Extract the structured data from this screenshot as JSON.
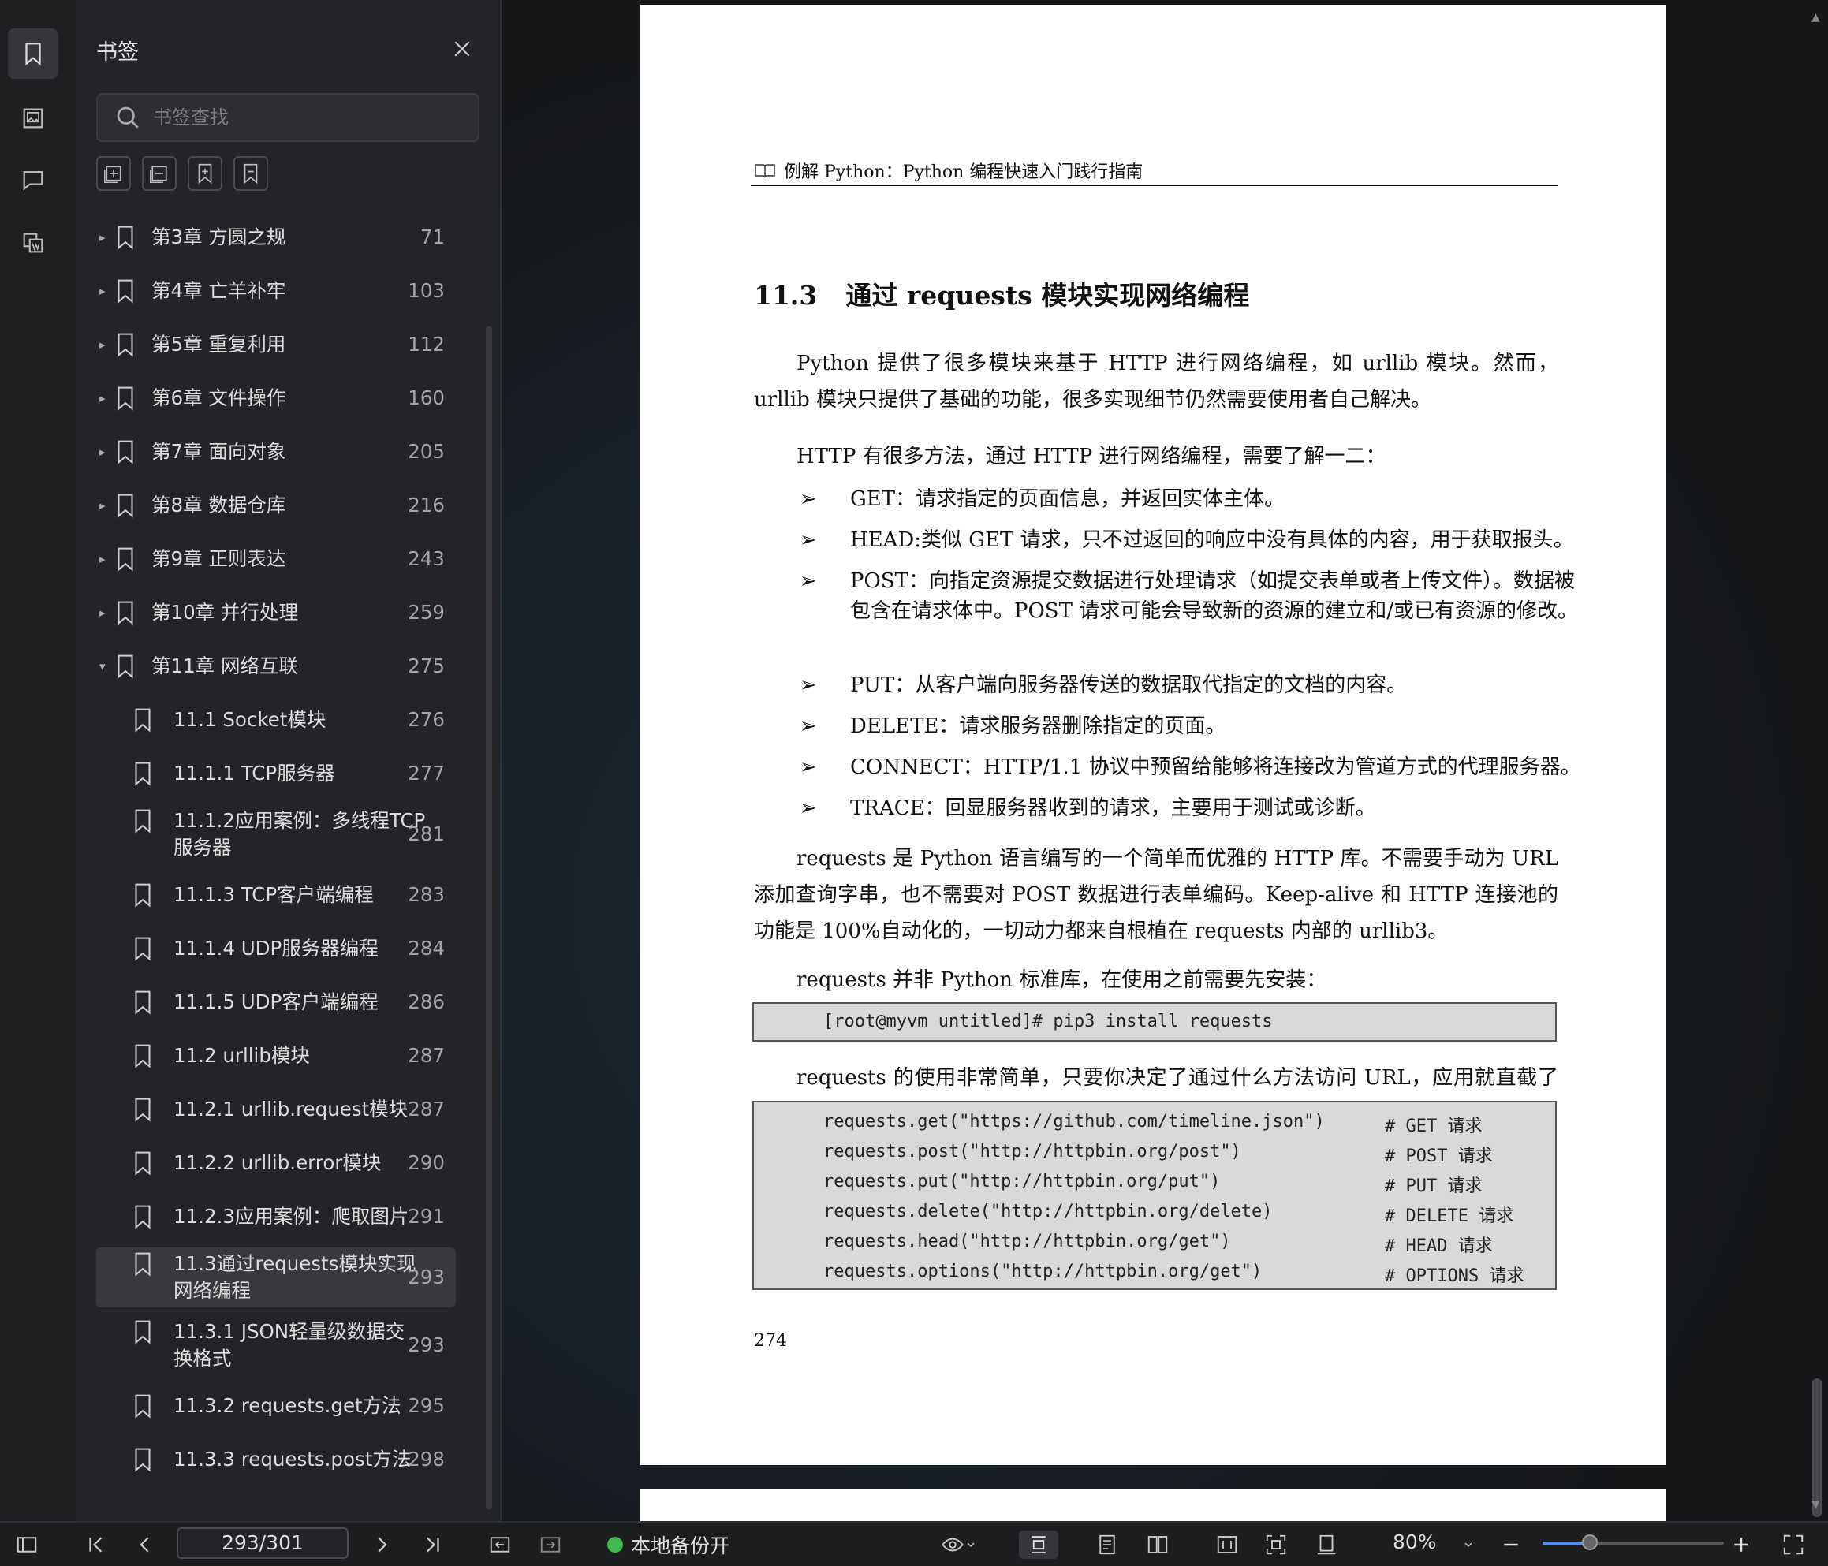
{
  "sidebar": {
    "title": "书签",
    "search_placeholder": "书签查找",
    "items": [
      {
        "label": "第3章 方圆之规",
        "page": "71",
        "level": 0,
        "caret": "▸"
      },
      {
        "label": "第4章 亡羊补牢",
        "page": "103",
        "level": 0,
        "caret": "▸"
      },
      {
        "label": "第5章 重复利用",
        "page": "112",
        "level": 0,
        "caret": "▸"
      },
      {
        "label": "第6章 文件操作",
        "page": "160",
        "level": 0,
        "caret": "▸"
      },
      {
        "label": "第7章 面向对象",
        "page": "205",
        "level": 0,
        "caret": "▸"
      },
      {
        "label": "第8章 数据仓库",
        "page": "216",
        "level": 0,
        "caret": "▸"
      },
      {
        "label": "第9章 正则表达",
        "page": "243",
        "level": 0,
        "caret": "▸"
      },
      {
        "label": "第10章 并行处理",
        "page": "259",
        "level": 0,
        "caret": "▸"
      },
      {
        "label": "第11章 网络互联",
        "page": "275",
        "level": 0,
        "caret": "▾"
      },
      {
        "label": "11.1 Socket模块",
        "page": "276",
        "level": 1
      },
      {
        "label": "11.1.1 TCP服务器",
        "page": "277",
        "level": 1
      },
      {
        "label": "11.1.2应用案例：多线程TCP",
        "label2": "服务器",
        "page": "281",
        "level": 1
      },
      {
        "label": "11.1.3 TCP客户端编程",
        "page": "283",
        "level": 1
      },
      {
        "label": "11.1.4 UDP服务器编程",
        "page": "284",
        "level": 1
      },
      {
        "label": "11.1.5 UDP客户端编程",
        "page": "286",
        "level": 1
      },
      {
        "label": "11.2 urllib模块",
        "page": "287",
        "level": 1
      },
      {
        "label": "11.2.1 urllib.request模块",
        "page": "287",
        "level": 1
      },
      {
        "label": "11.2.2 urllib.error模块",
        "page": "290",
        "level": 1
      },
      {
        "label": "11.2.3应用案例：爬取图片",
        "page": "291",
        "level": 1
      },
      {
        "label": "11.3通过requests模块实现",
        "label2": "网络编程",
        "page": "293",
        "level": 1,
        "selected": true
      },
      {
        "label": "11.3.1 JSON轻量级数据交",
        "label2": "换格式",
        "page": "293",
        "level": 1
      },
      {
        "label": "11.3.2 requests.get方法",
        "page": "295",
        "level": 1
      },
      {
        "label": "11.3.3 requests.post方法",
        "page": "298",
        "level": 1
      }
    ]
  },
  "document": {
    "running_head": "例解 Python：Python 编程快速入门践行指南",
    "section_number": "11.3",
    "section_title": "通过 requests 模块实现网络编程",
    "p1": "Python 提供了很多模块来基于 HTTP 进行网络编程，如 urllib 模块。然而，urllib 模块只提供了基础的功能，很多实现细节仍然需要使用者自己解决。",
    "p2": "HTTP 有很多方法，通过 HTTP 进行网络编程，需要了解一二：",
    "bullet_marker": "➢",
    "bullets": [
      "GET：请求指定的页面信息，并返回实体主体。",
      "HEAD:类似 GET 请求，只不过返回的响应中没有具体的内容，用于获取报头。",
      "POST：向指定资源提交数据进行处理请求（如提交表单或者上传文件）。数据被包含在请求体中。POST 请求可能会导致新的资源的建立和/或已有资源的修改。",
      "PUT：从客户端向服务器传送的数据取代指定的文档的内容。",
      "DELETE：请求服务器删除指定的页面。",
      "CONNECT：HTTP/1.1 协议中预留给能够将连接改为管道方式的代理服务器。",
      "TRACE：回显服务器收到的请求，主要用于测试或诊断。"
    ],
    "p3": "requests 是 Python 语言编写的一个简单而优雅的 HTTP 库。不需要手动为 URL 添加查询字串，也不需要对 POST 数据进行表单编码。Keep-alive 和 HTTP 连接池的功能是 100%自动化的，一切动力都来自根植在 requests 内部的 urllib3。",
    "p4": "requests 并非 Python 标准库，在使用之前需要先安装：",
    "code1": "[root@myvm untitled]# pip3 install requests",
    "p5": "requests 的使用非常简单，只要你决定了通过什么方法访问 URL，应用就直截了当：",
    "code2": [
      {
        "code": "requests.get(\"https://github.com/timeline.json\")",
        "comment": "# GET 请求"
      },
      {
        "code": "requests.post(\"http://httpbin.org/post\")",
        "comment": "# POST 请求"
      },
      {
        "code": "requests.put(\"http://httpbin.org/put\")",
        "comment": "# PUT 请求"
      },
      {
        "code": "requests.delete(\"http://httpbin.org/delete)",
        "comment": "# DELETE 请求"
      },
      {
        "code": "requests.head(\"http://httpbin.org/get\")",
        "comment": "# HEAD 请求"
      },
      {
        "code": "requests.options(\"http://httpbin.org/get\")",
        "comment": "# OPTIONS 请求"
      }
    ],
    "page_number": "274"
  },
  "toolbar": {
    "page_indicator": "293/301",
    "backup_label": "本地备份开",
    "backup_color": "#3fb950",
    "zoom": "80%",
    "zoom_level": 0.26
  },
  "colors": {
    "accent": "#4b8ef5",
    "selected_row": "#38393d"
  }
}
